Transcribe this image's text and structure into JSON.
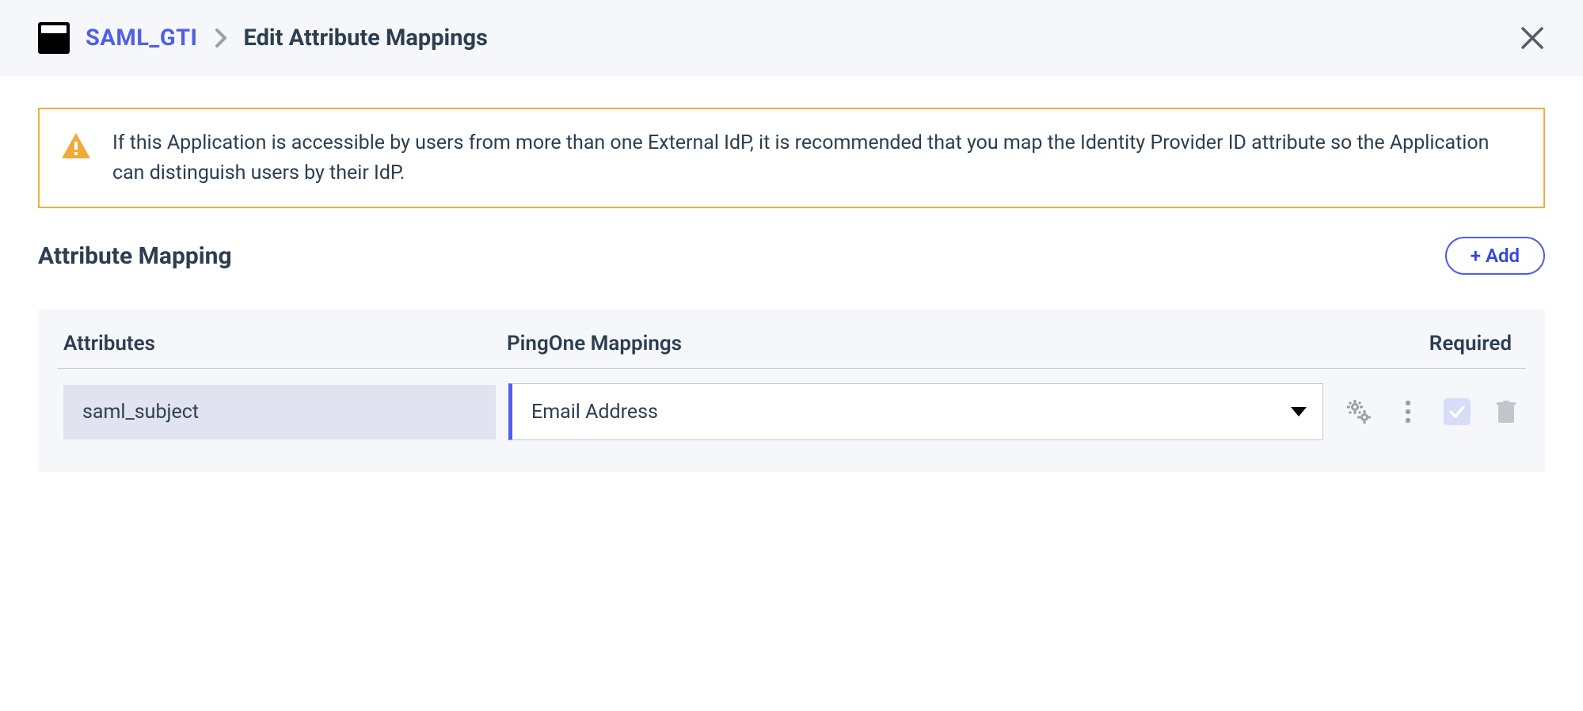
{
  "breadcrumb": {
    "link": "SAML_GTI",
    "current": "Edit Attribute Mappings"
  },
  "alert": {
    "text": "If this Application is accessible by users from more than one External IdP, it is recommended that you map the Identity Provider ID attribute so the Application can distinguish users by their IdP."
  },
  "section": {
    "title": "Attribute Mapping",
    "add_label": "+ Add"
  },
  "table": {
    "headers": {
      "attributes": "Attributes",
      "mappings": "PingOne Mappings",
      "required": "Required"
    },
    "rows": [
      {
        "attribute": "saml_subject",
        "mapping": "Email Address",
        "required": true
      }
    ]
  }
}
